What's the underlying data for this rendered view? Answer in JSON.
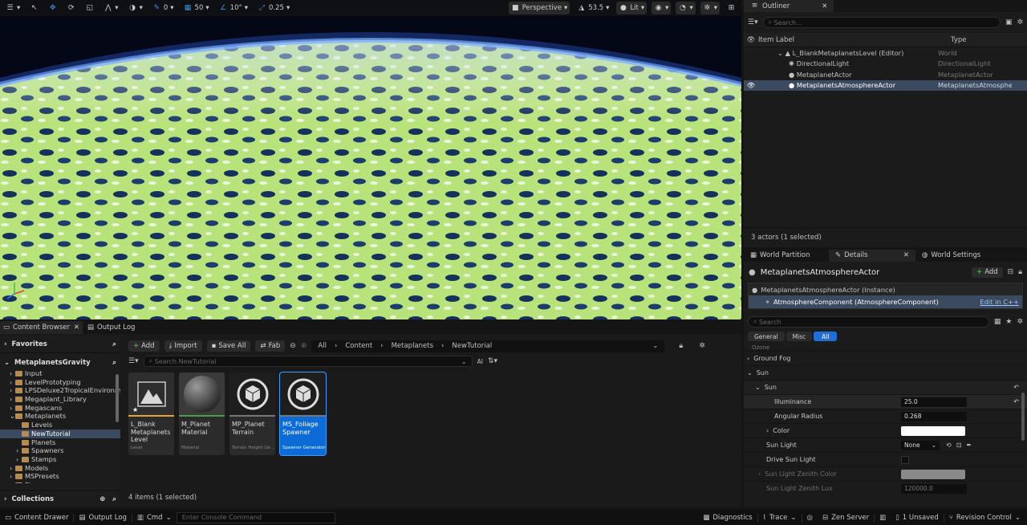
{
  "viewport": {
    "camera_speed": "0.25",
    "grid_snap": "50",
    "rotation_snap": "10°",
    "translate_snap": "0",
    "view_mode": "Perspective",
    "fov": "53.5",
    "lit_mode": "Lit"
  },
  "outliner": {
    "tab_label": "Outliner",
    "search_placeholder": "Search...",
    "col_item_label": "Item Label",
    "col_type": "Type",
    "rows": [
      {
        "label": "L_BlankMetaplanetsLevel (Editor)",
        "type": "World"
      },
      {
        "label": "DirectionalLight",
        "type": "DirectionalLight"
      },
      {
        "label": "MetaplanetActor",
        "type": "MetaplanetActor"
      },
      {
        "label": "MetaplanetsAtmosphereActor",
        "type": "MetaplanetsAtmospher"
      }
    ],
    "status": "3 actors (1 selected)"
  },
  "details": {
    "tabs": [
      "World Partition",
      "Details",
      "World Settings"
    ],
    "actor_name": "MetaplanetsAtmosphereActor",
    "add_label": "Add",
    "instance_label": "MetaplanetsAtmosphereActor (Instance)",
    "component_label": "AtmosphereComponent (AtmosphereComponent)",
    "edit_cpp": "Edit in C++",
    "search_placeholder": "Search",
    "filters": [
      "General",
      "Misc",
      "All"
    ],
    "partial_top": "Ozone",
    "ground_fog": "Ground Fog",
    "sun_category": "Sun",
    "sun_group": "Sun",
    "illuminance_label": "Illuminance",
    "illuminance_value": "25.0",
    "angular_radius_label": "Angular Radius",
    "angular_radius_value": "0.268",
    "color_label": "Color",
    "sun_light_label": "Sun Light",
    "sun_light_value": "None",
    "drive_sun_light_label": "Drive Sun Light",
    "zenith_color_label": "Sun Light Zenith Color",
    "zenith_lux_label": "Sun Light Zenith Lux",
    "zenith_lux_value": "120000.0"
  },
  "content_browser": {
    "tab_label": "Content Browser",
    "output_log_tab": "Output Log",
    "favorites": "Favorites",
    "project": "MetaplanetsGravity",
    "collections": "Collections",
    "add": "Add",
    "import": "Import",
    "save_all": "Save All",
    "fab": "Fab",
    "breadcrumb": [
      "All",
      "Content",
      "Metaplanets",
      "NewTutorial"
    ],
    "search_placeholder": "Search NewTutorial",
    "ai_label": "AI",
    "tree": [
      {
        "label": "Input",
        "indent": 2,
        "folder": true
      },
      {
        "label": "LevelPrototyping",
        "indent": 2,
        "folder": true
      },
      {
        "label": "LPSDeluxe2TropicalEnvironment",
        "indent": 2,
        "folder": true
      },
      {
        "label": "Megaplant_Library",
        "indent": 2,
        "folder": true
      },
      {
        "label": "Megascans",
        "indent": 2,
        "folder": true
      },
      {
        "label": "Metaplanets",
        "indent": 2,
        "folder": true
      },
      {
        "label": "Levels",
        "indent": 3,
        "folder": true
      },
      {
        "label": "NewTutorial",
        "indent": 3,
        "folder": true
      },
      {
        "label": "Planets",
        "indent": 3,
        "folder": true
      },
      {
        "label": "Spawners",
        "indent": 3,
        "folder": true
      },
      {
        "label": "Stamps",
        "indent": 3,
        "folder": true
      },
      {
        "label": "Models",
        "indent": 2,
        "folder": true
      },
      {
        "label": "MSPresets",
        "indent": 2,
        "folder": true
      },
      {
        "label": "Player",
        "indent": 2,
        "folder": true
      }
    ],
    "assets": [
      {
        "name": "L_Blank Metaplanets Level",
        "type": "Level"
      },
      {
        "name": "M_Planet Material",
        "type": "Material"
      },
      {
        "name": "MP_Planet Terrain",
        "type": "Terrain Height Ge..."
      },
      {
        "name": "MS_Foliage Spawner",
        "type": "Spawner Generator"
      }
    ],
    "status": "4 items (1 selected)"
  },
  "statusbar": {
    "content_drawer": "Content Drawer",
    "output_log": "Output Log",
    "cmd": "Cmd",
    "console_placeholder": "Enter Console Command",
    "diagnostics": "Diagnostics",
    "trace": "Trace",
    "zen_server": "Zen Server",
    "unsaved": "1 Unsaved",
    "revision_control": "Revision Control"
  }
}
